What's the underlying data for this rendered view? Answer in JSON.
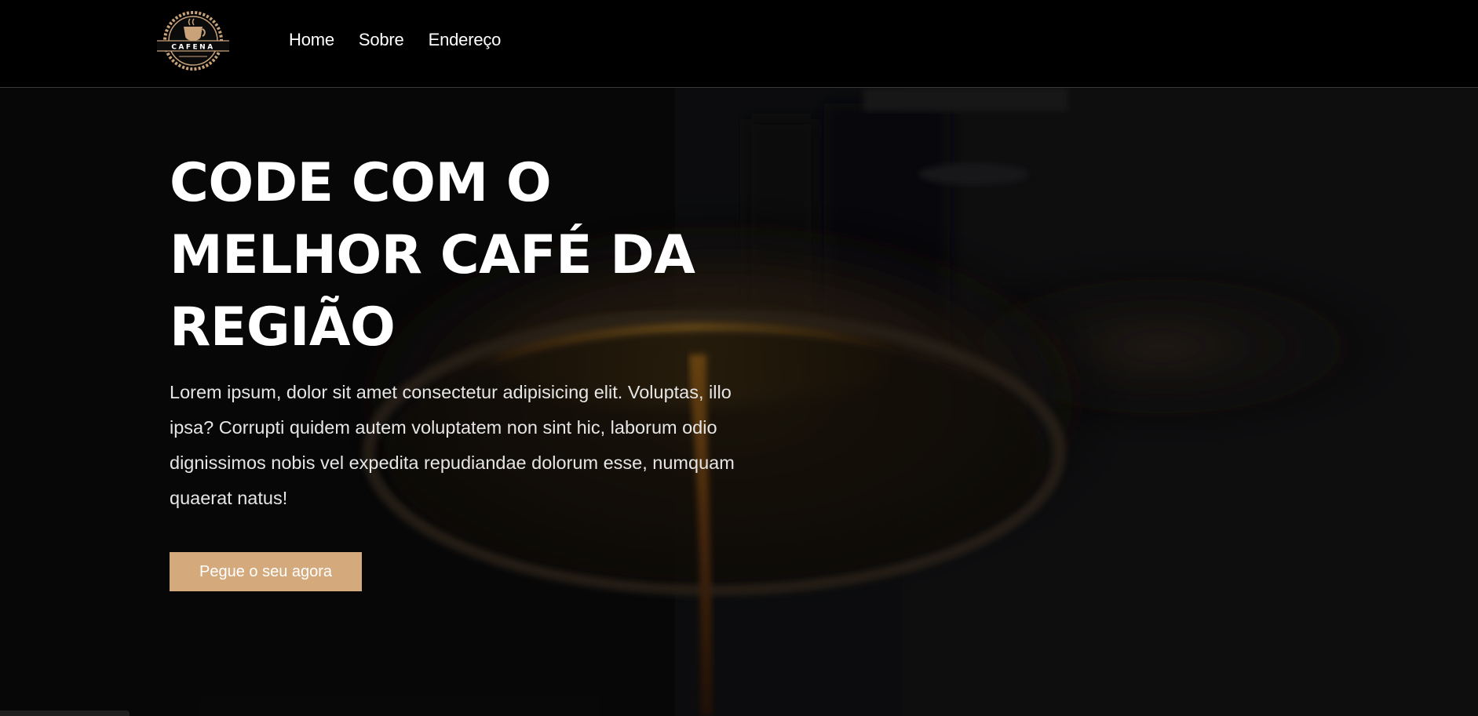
{
  "brand": {
    "logo_text": "CAFENA"
  },
  "nav": {
    "items": [
      {
        "label": "Home"
      },
      {
        "label": "Sobre"
      },
      {
        "label": "Endereço"
      }
    ]
  },
  "hero": {
    "title": "Code com o melhor café da região",
    "description": "Lorem ipsum, dolor sit amet consectetur adipisicing elit. Voluptas, illo ipsa? Corrupti quidem autem voluptatem non sint hic, laborum odio dignissimos nobis vel expedita repudiandae dolorum esse, numquam quaerat natus!",
    "cta_label": "Pegue o seu agora"
  },
  "colors": {
    "accent": "#d4aa7d",
    "navbar_bg": "#000000",
    "text": "#ffffff"
  }
}
